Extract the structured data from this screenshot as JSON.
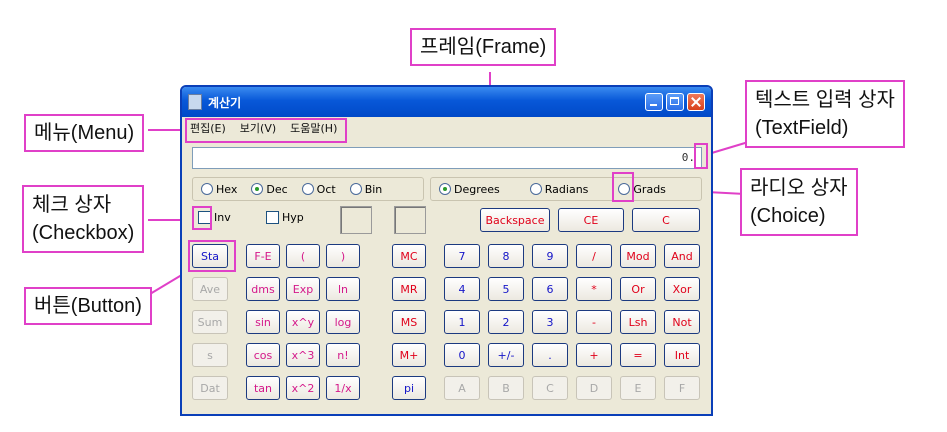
{
  "window": {
    "title": "계산기",
    "menu": [
      "편집(E)",
      "보기(V)",
      "도움말(H)"
    ],
    "display_value": "0.",
    "number_system": [
      "Hex",
      "Dec",
      "Oct",
      "Bin"
    ],
    "number_system_selected": "Dec",
    "angle_units": [
      "Degrees",
      "Radians",
      "Grads"
    ],
    "angle_selected": "Degrees",
    "checkboxes": [
      "Inv",
      "Hyp"
    ],
    "edit_buttons": [
      "Backspace",
      "CE",
      "C"
    ],
    "stat_buttons": [
      "Sta",
      "Ave",
      "Sum",
      "s",
      "Dat"
    ],
    "sci_buttons": [
      [
        "F-E",
        "(",
        ")"
      ],
      [
        "dms",
        "Exp",
        "ln"
      ],
      [
        "sin",
        "x^y",
        "log"
      ],
      [
        "cos",
        "x^3",
        "n!"
      ],
      [
        "tan",
        "x^2",
        "1/x"
      ]
    ],
    "mem_buttons": [
      "MC",
      "MR",
      "MS",
      "M+",
      "pi"
    ],
    "pad": [
      [
        "7",
        "8",
        "9",
        "/",
        "Mod",
        "And"
      ],
      [
        "4",
        "5",
        "6",
        "*",
        "Or",
        "Xor"
      ],
      [
        "1",
        "2",
        "3",
        "-",
        "Lsh",
        "Not"
      ],
      [
        "0",
        "+/-",
        ".",
        "+",
        "=",
        "Int"
      ],
      [
        "A",
        "B",
        "C",
        "D",
        "E",
        "F"
      ]
    ]
  },
  "callouts": {
    "frame": "프레임(Frame)",
    "textfield_1": "텍스트 입력 상자",
    "textfield_2": "(TextField)",
    "menu": "메뉴(Menu)",
    "choice_1": "라디오 상자",
    "choice_2": "(Choice)",
    "checkbox_1": "체크 상자",
    "checkbox_2": "(Checkbox)",
    "button": "버튼(Button)"
  },
  "colors": {
    "callout_border": "#e040c8",
    "titlebar": "#0858d8",
    "window_bg": "#ece9d8"
  }
}
